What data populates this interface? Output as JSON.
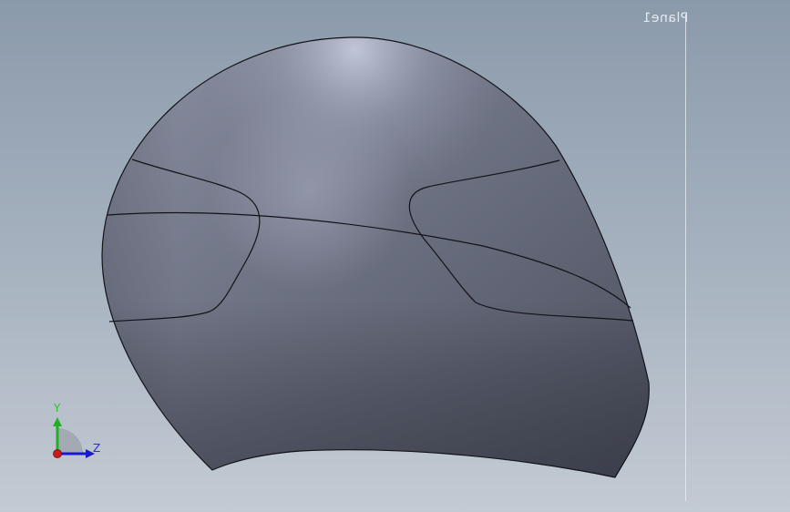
{
  "plane": {
    "label": "Plane1"
  },
  "triad": {
    "y_label": "Y",
    "z_label": "Z",
    "colors": {
      "y_axis": "#20b020",
      "z_axis": "#1a1acc",
      "x_axis": "#cc1a1a"
    }
  },
  "viewport": {
    "background_top": "#8b9aab",
    "background_bottom": "#c3cad3",
    "model_color": "#6d7383"
  }
}
